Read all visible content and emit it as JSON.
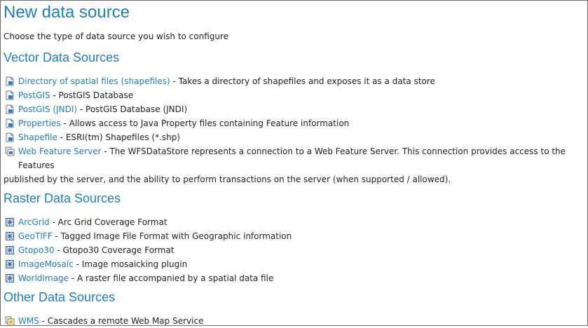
{
  "page": {
    "title": "New data source",
    "intro": "Choose the type of data source you wish to configure"
  },
  "vector": {
    "heading": "Vector Data Sources",
    "items": [
      {
        "name": "Directory of spatial files (shapefiles)",
        "desc": "Takes a directory of shapefiles and exposes it as a data store",
        "icon": "vector-store-icon"
      },
      {
        "name": "PostGIS",
        "desc": "PostGIS Database",
        "icon": "vector-store-icon"
      },
      {
        "name": "PostGIS (JNDI)",
        "desc": "PostGIS Database (JNDI)",
        "icon": "vector-store-icon"
      },
      {
        "name": "Properties",
        "desc": "Allows access to Java Property files containing Feature information",
        "icon": "vector-store-icon"
      },
      {
        "name": "Shapefile",
        "desc": "ESRI(tm) Shapefiles (*.shp)",
        "icon": "vector-store-icon"
      },
      {
        "name": "Web Feature Server",
        "desc": "The WFSDataStore represents a connection to a Web Feature Server. This connection provides access to the Features",
        "desc_cont": "published by the server, and the ability to perform transactions on the server (when supported / allowed).",
        "icon": "wfs-store-icon"
      }
    ]
  },
  "raster": {
    "heading": "Raster Data Sources",
    "items": [
      {
        "name": "ArcGrid",
        "desc": "Arc Grid Coverage Format",
        "icon": "raster-store-icon"
      },
      {
        "name": "GeoTIFF",
        "desc": "Tagged Image File Format with Geographic information",
        "icon": "raster-store-icon"
      },
      {
        "name": "Gtopo30",
        "desc": "Gtopo30 Coverage Format",
        "icon": "raster-store-icon"
      },
      {
        "name": "ImageMosaic",
        "desc": "Image mosaicking plugin",
        "icon": "raster-store-icon"
      },
      {
        "name": "WorldImage",
        "desc": "A raster file accompanied by a spatial data file",
        "icon": "raster-store-icon"
      }
    ]
  },
  "other": {
    "heading": "Other Data Sources",
    "items": [
      {
        "name": "WMS",
        "desc": "Cascades a remote Web Map Service",
        "icon": "wms-store-icon"
      }
    ]
  },
  "separator": " - ",
  "colors": {
    "link": "#1f7fb6",
    "text": "#222222",
    "border": "#6b6b6b"
  }
}
